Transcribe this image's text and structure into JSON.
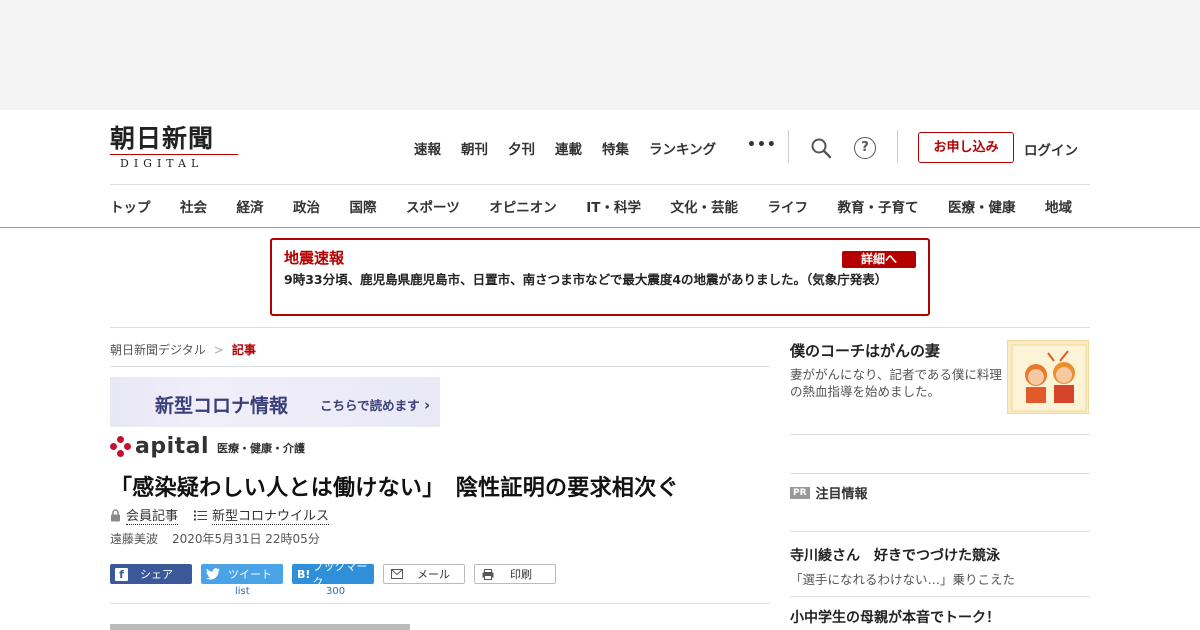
{
  "header": {
    "logo_jp": "朝日新聞",
    "logo_en": "DIGITAL",
    "topnav": [
      "速報",
      "朝刊",
      "夕刊",
      "連載",
      "特集",
      "ランキング"
    ],
    "more_label": "•••",
    "help_label": "?",
    "apply_label": "お申し込み",
    "login_label": "ログイン"
  },
  "catnav": [
    "トップ",
    "社会",
    "経済",
    "政治",
    "国際",
    "スポーツ",
    "オピニオン",
    "IT・科学",
    "文化・芸能",
    "ライフ",
    "教育・子育て",
    "医療・健康",
    "地域"
  ],
  "alert": {
    "title": "地震速報",
    "button": "詳細へ",
    "body": "9時33分頃、鹿児島県鹿児島市、日置市、南さつま市などで最大震度4の地震がありました。（気象庁発表）"
  },
  "breadcrumb": {
    "home": "朝日新聞デジタル",
    "sep": ">",
    "current": "記事"
  },
  "corona_banner": {
    "main": "新型コロナ情報",
    "sub": "こちらで読めます"
  },
  "apital": {
    "name": "apital",
    "tag": "医療・健康・介護"
  },
  "article": {
    "headline": "「感染疑わしい人とは働けない」　陰性証明の要求相次ぐ",
    "member_label": "会員記事",
    "topic_label": "新型コロナウイルス",
    "author": "遠藤美波",
    "date": "2020年5月31日 22時05分"
  },
  "share": {
    "facebook": "シェア",
    "twitter": "ツイート",
    "hatena": "ブックマーク",
    "hatena_logo": "B!",
    "mail": "メール",
    "print": "印刷",
    "twitter_count": "list",
    "hatena_count": "300"
  },
  "sidebar": {
    "feature_title": "僕のコーチはがんの妻",
    "feature_desc": "妻ががんになり、記者である僕に料理の熱血指導を始めました。",
    "pr_badge": "PR",
    "pr_heading": "注目情報",
    "pr_items": [
      {
        "title": "寺川綾さん　好きでつづけた競泳",
        "desc": "「選手になれるわけない…」乗りこえた"
      },
      {
        "title": "小中学生の母親が本音でトーク！",
        "desc": ""
      }
    ]
  },
  "colors": {
    "brand_red": "#b50000",
    "corona_navy": "#3a3f7a",
    "facebook": "#3b5998",
    "twitter": "#4aa3e6",
    "hatena": "#2f8fd8"
  }
}
